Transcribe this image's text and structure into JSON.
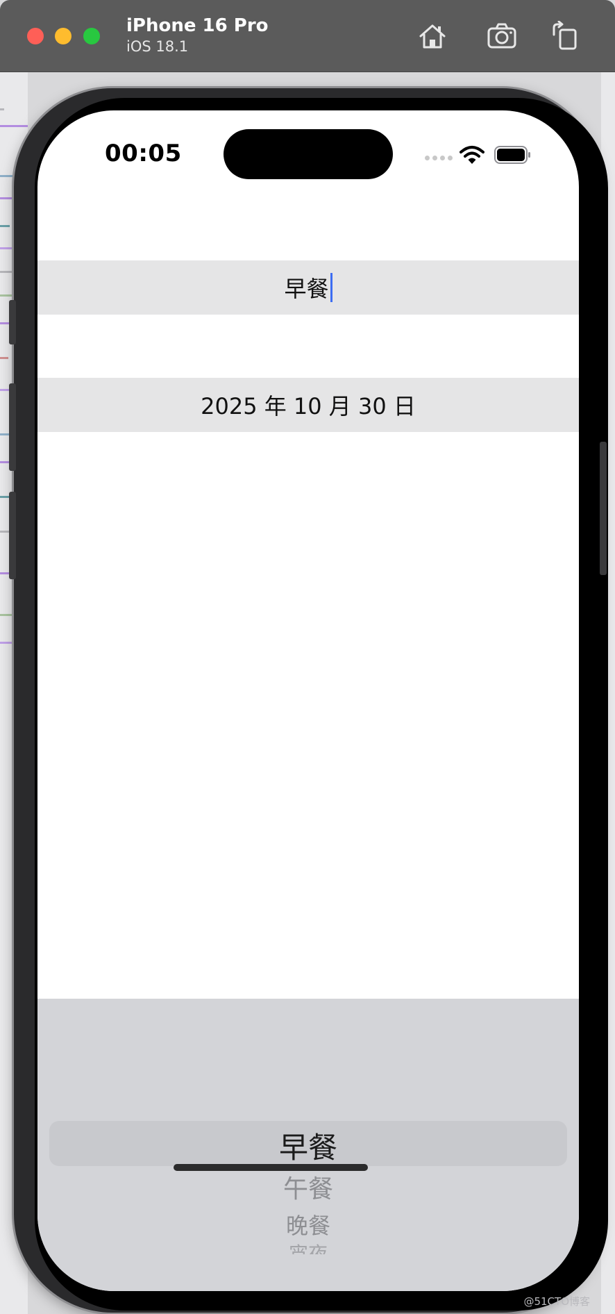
{
  "simulator": {
    "device_name": "iPhone 16 Pro",
    "os_version": "iOS 18.1",
    "toolbar_icons": [
      "home-icon",
      "screenshot-icon",
      "rotate-icon"
    ]
  },
  "status_bar": {
    "time": "00:05",
    "icons": [
      "cellular-icon",
      "wifi-icon",
      "battery-icon"
    ]
  },
  "form": {
    "meal_value": "早餐",
    "date_value": "2025 年 10 月 30 日"
  },
  "picker": {
    "options": [
      "早餐",
      "午餐",
      "晚餐",
      "宵夜"
    ],
    "selected_index": 0
  },
  "watermark": "@51CTO博客",
  "colors": {
    "caret": "#3d6df2",
    "field_background": "#e5e5e6",
    "picker_background": "#d3d4d8"
  }
}
